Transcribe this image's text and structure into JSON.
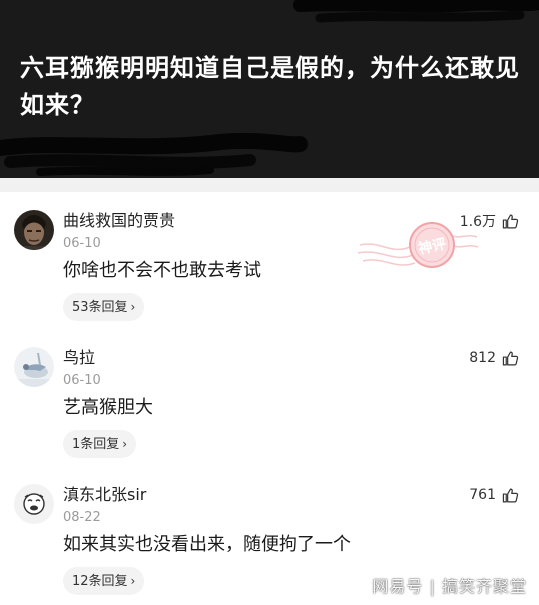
{
  "question": {
    "title": "六耳猕猴明明知道自己是假的，为什么还敢见如来？"
  },
  "comments": [
    {
      "username": "曲线救国的贾贵",
      "date": "06-10",
      "text": "你啥也不会不也敢去考试",
      "replies": "53条回复",
      "likes": "1.6万",
      "avatar": "dark-portrait-avatar"
    },
    {
      "username": "鸟拉",
      "date": "06-10",
      "text": "艺高猴胆大",
      "replies": "1条回复",
      "likes": "812",
      "avatar": "bird-avatar"
    },
    {
      "username": "滇东北张sir",
      "date": "08-22",
      "text": "如来其实也没看出来，随便拘了一个",
      "replies": "12条回复",
      "likes": "761",
      "avatar": "cartoon-face-avatar"
    }
  ],
  "stamp": {
    "text": "神评",
    "color": "#f2a3a8"
  },
  "watermark": {
    "text": "网易号 | 搞笑齐聚堂"
  },
  "colors": {
    "header_bg": "#1a1a1a",
    "divider": "#f1f1f1",
    "pill_bg": "#f3f3f3"
  }
}
